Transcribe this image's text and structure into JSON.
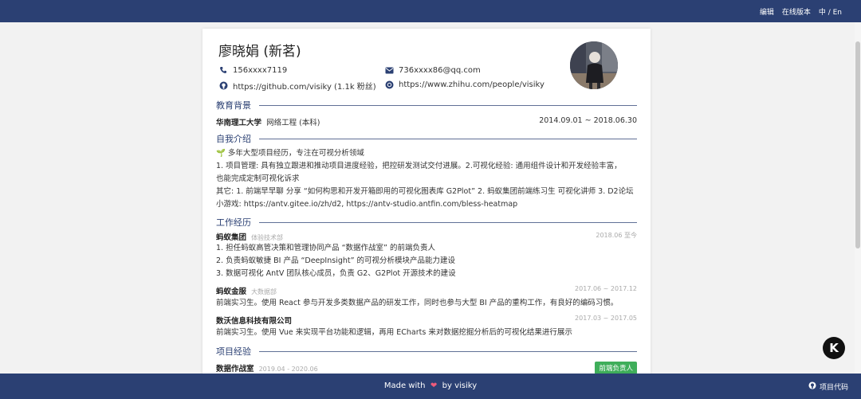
{
  "topbar": {
    "edit": "编辑",
    "online": "在线版本",
    "lang": "中 / En"
  },
  "profile": {
    "name": "廖晓娟 (新茗)",
    "phone": "156xxxx7119",
    "email": "736xxxx86@qq.com",
    "github": "https://github.com/visiky (1.1k 粉丝)",
    "zhihu": "https://www.zhihu.com/people/visiky"
  },
  "education": {
    "title": "教育背景",
    "school": "华南理工大学",
    "major": "网络工程 (本科)",
    "period": "2014.09.01 ~ 2018.06.30"
  },
  "intro": {
    "title": "自我介绍",
    "line1": "🌱 多年大型项目经历，专注在可视分析领域",
    "line2": "1. 项目管理: 具有独立跟进和推动项目进度经验，把控研发测试交付进展。2.可视化经验: 通用组件设计和开发经验丰富，",
    "line3": "也能完成定制可视化诉求",
    "line4": "其它: 1. 前端早早聊 分享 “如何构思和开发开箱即用的可视化图表库 G2Plot” 2. 蚂蚁集团前端练习生 可视化讲师 3. D2论坛",
    "line5": "小游戏: https://antv.gitee.io/zh/d2, https://antv-studio.antfin.com/bless-heatmap"
  },
  "work": {
    "title": "工作经历",
    "jobs": [
      {
        "company": "蚂蚁集团",
        "dept": "体验技术部",
        "period": "2018.06 至今",
        "items": [
          "1. 担任蚂蚁高管决策和管理协同产品 “数据作战室” 的前端负责人",
          "2. 负责蚂蚁敏捷 BI 产品 “DeepInsight” 的可视分析模块产品能力建设",
          "3. 数据可视化 AntV 团队核心成员，负责 G2、G2Plot 开源技术的建设"
        ]
      },
      {
        "company": "蚂蚁金服",
        "dept": "大数据部",
        "period": "2017.06 ~ 2017.12",
        "desc": "前端实习生。使用 React 参与开发多类数据产品的研发工作，同时也参与大型 BI 产品的重构工作，有良好的编码习惯。"
      },
      {
        "company": "数沃信息科技有限公司",
        "dept": "",
        "period": "2017.03 ~ 2017.05",
        "desc": "前端实习生。使用 Vue 来实现平台功能和逻辑，再用 ECharts 来对数据挖掘分析后的可视化结果进行展示"
      }
    ]
  },
  "projects": {
    "title": "项目经验",
    "name": "数据作战室",
    "period": "2019.04 - 2020.06",
    "role": "前端负责人"
  },
  "footer": {
    "made": "Made with",
    "by": "by visiky",
    "code": "项目代码"
  },
  "float_button": "K",
  "colors": {
    "primary": "#2b4073",
    "badge": "#3fae5a",
    "heart": "#ef5b7b"
  }
}
